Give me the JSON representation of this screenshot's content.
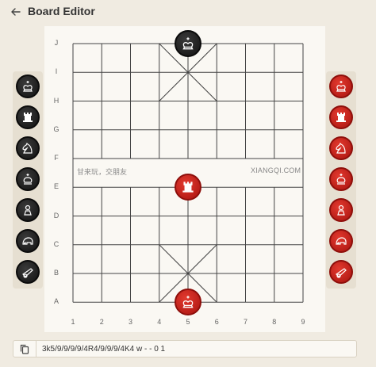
{
  "header": {
    "title": "Board Editor",
    "back_icon": "arrow-left-icon"
  },
  "board": {
    "rows": [
      "J",
      "I",
      "H",
      "G",
      "F",
      "E",
      "D",
      "C",
      "B",
      "A"
    ],
    "columns": [
      "1",
      "2",
      "3",
      "4",
      "5",
      "6",
      "7",
      "8",
      "9"
    ],
    "river_left_text": "甘来玩，交朋友",
    "river_right_text": "XIANGQI.COM",
    "pieces_on_board": [
      {
        "name": "black-general",
        "color": "black",
        "type": "king",
        "file": 4,
        "rank": 0
      },
      {
        "name": "red-rook",
        "color": "red",
        "type": "rook",
        "file": 4,
        "rank": 5
      },
      {
        "name": "red-general",
        "color": "red",
        "type": "king",
        "file": 4,
        "rank": 9
      }
    ]
  },
  "palette": {
    "black": [
      "king",
      "rook",
      "knight",
      "advisor",
      "pawn",
      "elephant",
      "cannon"
    ],
    "red": [
      "king",
      "rook",
      "knight",
      "advisor",
      "pawn",
      "elephant",
      "cannon"
    ]
  },
  "fen": {
    "value": "3k5/9/9/9/9/4R4/9/9/9/4K4 w - - 0 1",
    "copy_icon": "copy-icon"
  },
  "colors": {
    "black_piece": "#151515",
    "red_piece": "#c51f19",
    "grid": "#444444"
  }
}
